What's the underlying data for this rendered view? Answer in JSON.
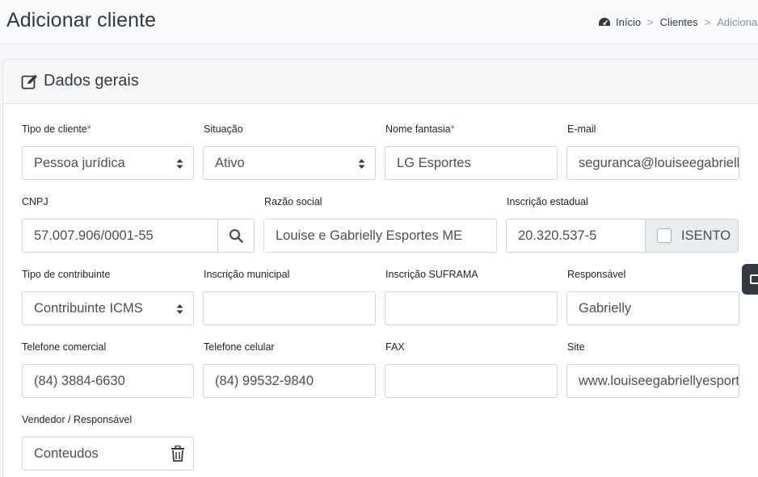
{
  "header": {
    "title": "Adicionar cliente",
    "breadcrumb": [
      "Início",
      "Clientes",
      "Adicionar"
    ]
  },
  "card": {
    "title": "Dados gerais"
  },
  "form": {
    "tipo_cliente": {
      "label": "Tipo de cliente",
      "required_mark": "*",
      "value": "Pessoa jurídica"
    },
    "situacao": {
      "label": "Situação",
      "value": "Ativo"
    },
    "nome_fantasia": {
      "label": "Nome fantasia",
      "required_mark": "*",
      "value": "LG Esportes"
    },
    "email": {
      "label": "E-mail",
      "value": "seguranca@louiseegabriellyesportes.com.br"
    },
    "cnpj": {
      "label": "CNPJ",
      "value": "57.007.906/0001-55"
    },
    "razao_social": {
      "label": "Razão social",
      "value": "Louise e Gabrielly Esportes ME"
    },
    "inscricao_estadual": {
      "label": "Inscrição estadual",
      "value": "20.320.537-5",
      "isento_label": "ISENTO",
      "isento_checked": false
    },
    "tipo_contribuinte": {
      "label": "Tipo de contribuinte",
      "value": "Contribuinte ICMS"
    },
    "inscricao_municipal": {
      "label": "Inscrição municipal",
      "value": ""
    },
    "inscricao_suframa": {
      "label": "Inscrição SUFRAMA",
      "value": ""
    },
    "responsavel": {
      "label": "Responsável",
      "value": "Gabrielly"
    },
    "telefone_comercial": {
      "label": "Telefone comercial",
      "value": "(84) 3884-6630"
    },
    "telefone_celular": {
      "label": "Telefone celular",
      "value": "(84) 99532-9840"
    },
    "fax": {
      "label": "FAX",
      "value": ""
    },
    "site": {
      "label": "Site",
      "value": "www.louiseegabriellyesportes.com.br"
    },
    "vendedor": {
      "label": "Vendedor / Responsável",
      "value": "Conteudos"
    }
  },
  "icons": {
    "breadcrumb_home": "dashboard-icon",
    "card_title": "edit-icon",
    "cnpj_search": "search-icon",
    "vendedor_remove": "trash-icon"
  }
}
